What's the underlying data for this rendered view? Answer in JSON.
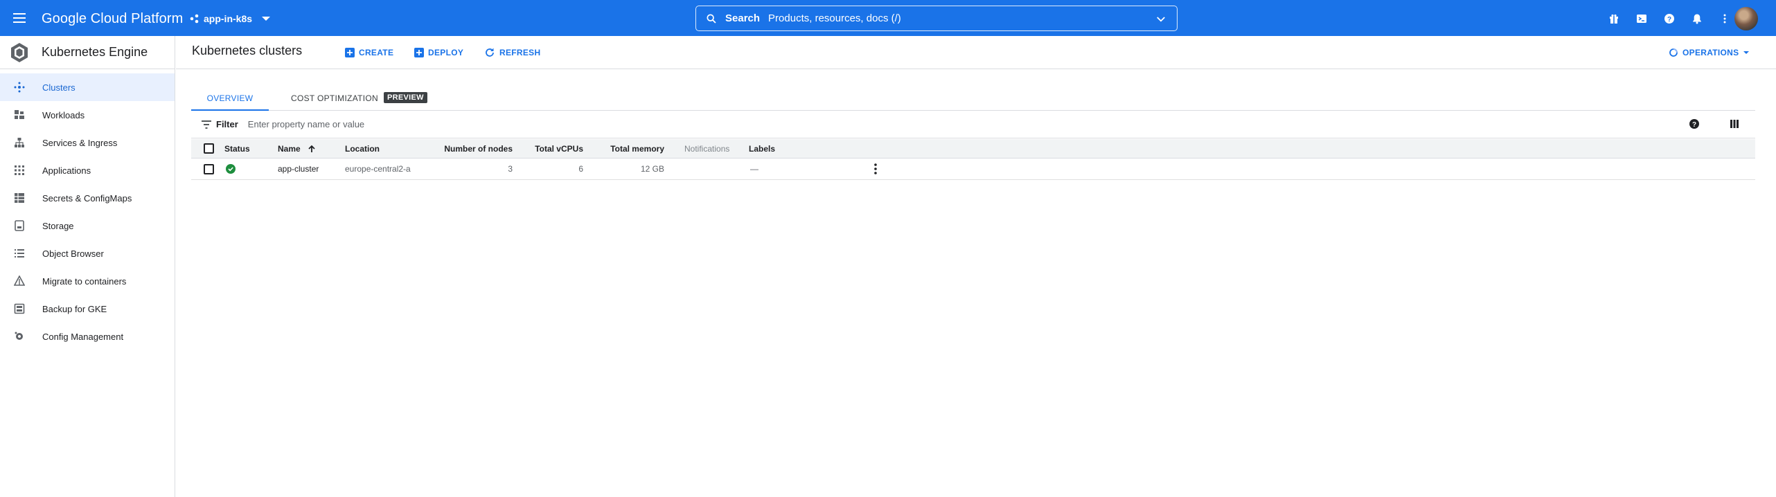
{
  "topbar": {
    "brand": "Google Cloud Platform",
    "project": "app-in-k8s",
    "search_label": "Search",
    "search_placeholder": "Products, resources, docs (/)"
  },
  "sidebar": {
    "product_title": "Kubernetes Engine",
    "items": [
      {
        "label": "Clusters",
        "icon": "clusters-icon",
        "active": true
      },
      {
        "label": "Workloads",
        "icon": "workloads-icon"
      },
      {
        "label": "Services & Ingress",
        "icon": "services-icon"
      },
      {
        "label": "Applications",
        "icon": "applications-icon"
      },
      {
        "label": "Secrets & ConfigMaps",
        "icon": "secrets-icon"
      },
      {
        "label": "Storage",
        "icon": "storage-icon"
      },
      {
        "label": "Object Browser",
        "icon": "object-browser-icon"
      },
      {
        "label": "Migrate to containers",
        "icon": "migrate-icon"
      },
      {
        "label": "Backup for GKE",
        "icon": "backup-icon"
      },
      {
        "label": "Config Management",
        "icon": "config-management-icon"
      }
    ]
  },
  "main": {
    "title": "Kubernetes clusters",
    "actions": {
      "create": "CREATE",
      "deploy": "DEPLOY",
      "refresh": "REFRESH",
      "operations": "OPERATIONS"
    },
    "tabs": [
      {
        "label": "OVERVIEW",
        "active": true
      },
      {
        "label": "COST OPTIMIZATION",
        "badge": "PREVIEW"
      }
    ],
    "filter": {
      "label": "Filter",
      "placeholder": "Enter property name or value"
    },
    "table": {
      "headers": {
        "status": "Status",
        "name": "Name",
        "location": "Location",
        "nodes": "Number of nodes",
        "vcpus": "Total vCPUs",
        "memory": "Total memory",
        "notifications": "Notifications",
        "labels": "Labels"
      },
      "rows": [
        {
          "status": "ok",
          "name": "app-cluster",
          "location": "europe-central2-a",
          "nodes": "3",
          "vcpus": "6",
          "memory": "12 GB",
          "notifications": "",
          "labels": "—"
        }
      ]
    }
  },
  "colors": {
    "accent": "#1a73e8",
    "status_ok": "#1e8e3e",
    "active_bg": "#e8f0fe"
  }
}
